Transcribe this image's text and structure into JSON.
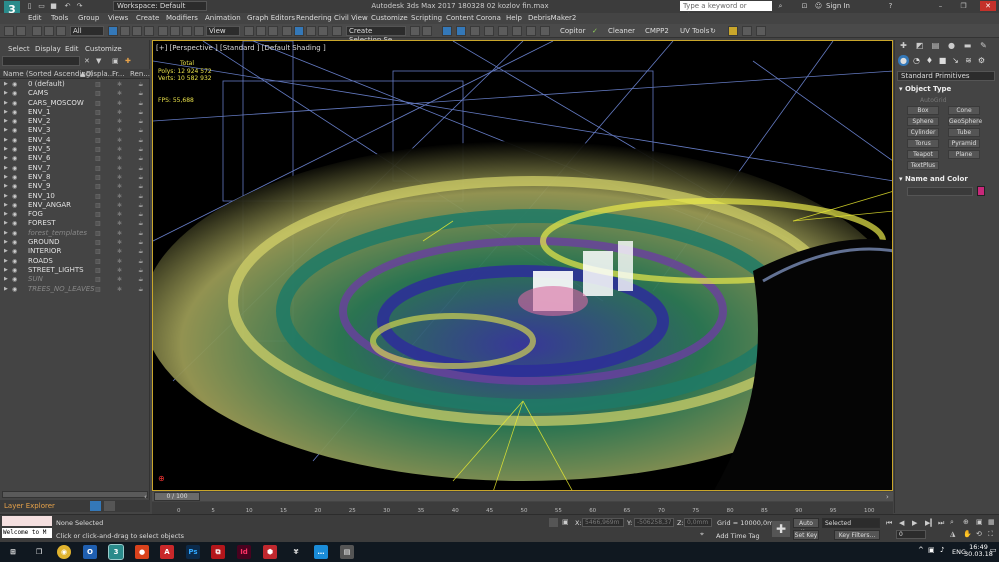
{
  "titlebar": {
    "workspace": "Workspace: Default",
    "title": "Autodesk 3ds Max 2017    180328 02 kozlov fin.max",
    "search_placeholder": "Type a keyword or phrase",
    "sign_in": "Sign In"
  },
  "menubar": [
    "Edit",
    "Tools",
    "Group",
    "Views",
    "Create",
    "Modifiers",
    "Animation",
    "Graph Editors",
    "Rendering",
    "Civil View",
    "Customize",
    "Scripting",
    "Content",
    "Corona",
    "Help",
    "DebrisMaker2"
  ],
  "toolbar": {
    "selection_filter": "All",
    "ref_coord": "View",
    "selection_set": "Create Selection Se",
    "copitor": "Copitor",
    "cleaner": "Cleaner",
    "cmpp2": "CMPP2",
    "uv_tools": "UV Tools"
  },
  "explorer": {
    "menu": [
      "Select",
      "Display",
      "Edit",
      "Customize"
    ],
    "columns": [
      "Name (Sorted Ascending)",
      "Displa...",
      "Fr...",
      "Ren..."
    ],
    "layers": [
      {
        "name": "0 (default)",
        "dim": false
      },
      {
        "name": "CAMS",
        "dim": false
      },
      {
        "name": "CARS_MOSCOW",
        "dim": false
      },
      {
        "name": "ENV_1",
        "dim": false
      },
      {
        "name": "ENV_2",
        "dim": false
      },
      {
        "name": "ENV_3",
        "dim": false
      },
      {
        "name": "ENV_4",
        "dim": false
      },
      {
        "name": "ENV_5",
        "dim": false
      },
      {
        "name": "ENV_6",
        "dim": false
      },
      {
        "name": "ENV_7",
        "dim": false
      },
      {
        "name": "ENV_8",
        "dim": false
      },
      {
        "name": "ENV_9",
        "dim": false
      },
      {
        "name": "ENV_10",
        "dim": false
      },
      {
        "name": "ENV_ANGAR",
        "dim": false
      },
      {
        "name": "FOG",
        "dim": false
      },
      {
        "name": "FOREST",
        "dim": false
      },
      {
        "name": "forest_templates",
        "dim": true
      },
      {
        "name": "GROUND",
        "dim": false
      },
      {
        "name": "INTERIOR",
        "dim": false
      },
      {
        "name": "ROADS",
        "dim": false
      },
      {
        "name": "STREET_LIGHTS",
        "dim": false
      },
      {
        "name": "SUN",
        "dim": true
      },
      {
        "name": "TREES_NO_LEAVES",
        "dim": true
      }
    ],
    "footer": "Layer Explorer"
  },
  "viewport": {
    "label": "[+] [Perspective ] [Standard ] [Default Shading ]",
    "stats": {
      "header": "Total",
      "polys_label": "Polys:",
      "polys": "12 924 572",
      "verts_label": "Verts:",
      "verts": "10 582 932",
      "fps_label": "FPS:",
      "fps": "55,688"
    }
  },
  "cmdpanel": {
    "category": "Standard Primitives",
    "object_type_title": "Object Type",
    "autogrid": "AutoGrid",
    "primitives": [
      "Box",
      "Cone",
      "Sphere",
      "GeoSphere",
      "Cylinder",
      "Tube",
      "Torus",
      "Pyramid",
      "Teapot",
      "Plane",
      "TextPlus"
    ],
    "name_color_title": "Name and Color",
    "swatch_color": "#c8287a"
  },
  "timeline": {
    "frame": "0 / 100",
    "ticks": [
      "0",
      "5",
      "10",
      "15",
      "20",
      "25",
      "30",
      "35",
      "40",
      "45",
      "50",
      "55",
      "60",
      "65",
      "70",
      "75",
      "80",
      "85",
      "90",
      "95",
      "100"
    ]
  },
  "status": {
    "maxscript": "Welcome to M",
    "selection": "None Selected",
    "prompt": "Click or click-and-drag to select objects",
    "x_label": "X:",
    "x_value": "5466,969m",
    "y_label": "Y:",
    "y_value": "-506258,37",
    "z_label": "Z:",
    "z_value": "0,0mm",
    "grid": "Grid = 10000,0mm",
    "add_time_tag": "Add Time Tag",
    "auto_key": "Auto Key",
    "set_key": "Set Key",
    "key_mode": "Selected",
    "key_filters": "Key Filters...",
    "frame_value": "0"
  },
  "taskbar": {
    "lang": "ENG",
    "time": "16:49",
    "date": "30.03.18"
  }
}
